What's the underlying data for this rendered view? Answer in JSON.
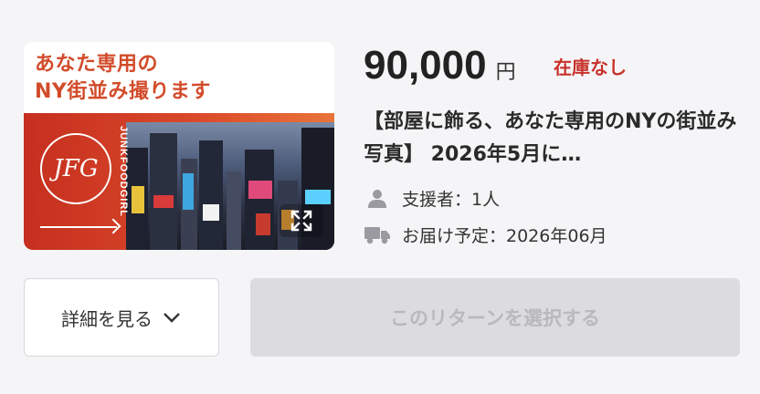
{
  "thumbnail": {
    "title_line1": "あなた専用の",
    "title_line2": "NY街並み撮ります",
    "logo_text": "JFG",
    "vertical_brand": "JUNKFOODGIRL",
    "accent_color": "#d24b2a",
    "expand_icon": "expand-icon"
  },
  "price": {
    "amount": "90,000",
    "unit": "円"
  },
  "stock": {
    "label": "在庫なし",
    "color": "#c8322b"
  },
  "reward": {
    "title": "【部屋に飾る、あなた専用のNYの街並み写真】 2026年5月に…"
  },
  "meta": {
    "supporters": {
      "icon": "person-icon",
      "text": "支援者：1人"
    },
    "delivery": {
      "icon": "truck-icon",
      "text": "お届け予定：2026年06月"
    }
  },
  "buttons": {
    "details_label": "詳細を見る",
    "select_label": "このリターンを選択する"
  }
}
